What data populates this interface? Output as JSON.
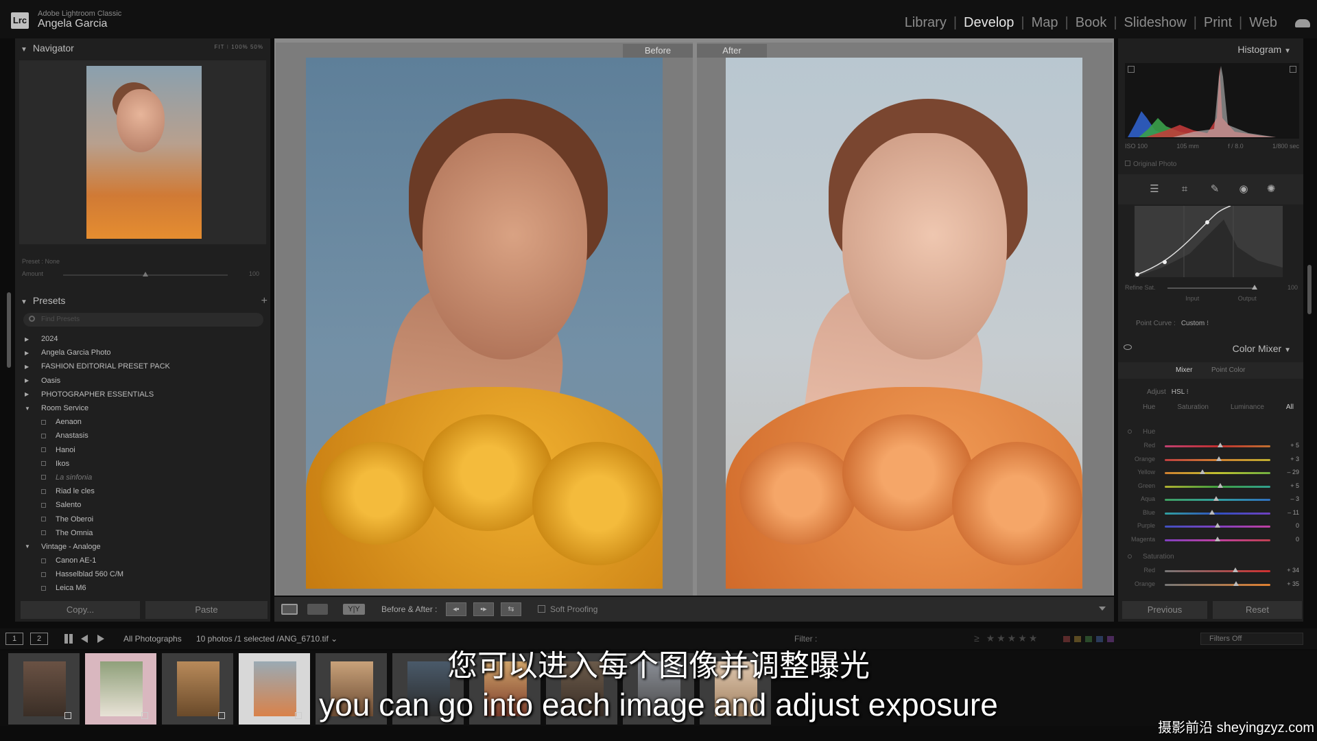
{
  "app": {
    "sub_title": "Adobe Lightroom Classic",
    "logo_text": "Lrc",
    "user_name": "Angela Garcia"
  },
  "modules": [
    "Library",
    "Develop",
    "Map",
    "Book",
    "Slideshow",
    "Print",
    "Web"
  ],
  "active_module": "Develop",
  "navigator": {
    "title": "Navigator",
    "zoom_options": "FIT ⁝  100%  50%"
  },
  "preset_amount": {
    "preset_label": "Preset : None",
    "amount_label": "Amount",
    "amount_value": "100",
    "amount_level": 0.5
  },
  "presets": {
    "title": "Presets",
    "add_label": "+",
    "search_placeholder": "Find Presets",
    "items": [
      {
        "label": "2024",
        "type": "group"
      },
      {
        "label": "Angela Garcia Photo",
        "type": "group"
      },
      {
        "label": "FASHION EDITORIAL PRESET PACK",
        "type": "group"
      },
      {
        "label": "Oasis",
        "type": "group"
      },
      {
        "label": "PHOTOGRAPHER ESSENTIALS",
        "type": "group"
      },
      {
        "label": "Room Service",
        "type": "group-open"
      },
      {
        "label": "Aenaon",
        "type": "child"
      },
      {
        "label": "Anastasis",
        "type": "child"
      },
      {
        "label": "Hanoi",
        "type": "child"
      },
      {
        "label": "Ikos",
        "type": "child"
      },
      {
        "label": "La sinfonia",
        "type": "child-dim"
      },
      {
        "label": "Riad le cles",
        "type": "child"
      },
      {
        "label": "Salento",
        "type": "child"
      },
      {
        "label": "The Oberoi",
        "type": "child"
      },
      {
        "label": "The Omnia",
        "type": "child"
      },
      {
        "label": "Vintage - Analoge",
        "type": "group-open"
      },
      {
        "label": "Canon AE-1",
        "type": "child"
      },
      {
        "label": "Hasselblad 560 C/M",
        "type": "child"
      },
      {
        "label": "Leica M6",
        "type": "child"
      }
    ]
  },
  "left_buttons": {
    "copy": "Copy...",
    "paste": "Paste"
  },
  "compare": {
    "before_label": "Before",
    "after_label": "After"
  },
  "toolbar": {
    "yy_label": "Y|Y",
    "before_after_label": "Before & After :",
    "copy_left": "◂▪",
    "copy_right": "▪▸",
    "swap": "⇆",
    "soft_proofing": "Soft Proofing"
  },
  "histogram": {
    "title": "Histogram",
    "iso": "ISO 100",
    "focal": "105 mm",
    "aperture": "f / 8.0",
    "shutter": "1/800 sec",
    "original_photo": "Original Photo"
  },
  "tone_curve": {
    "refine_label": "Refine Sat.",
    "refine_value": "100",
    "refine_level": 0.98,
    "input_label": "Input",
    "output_label": "Output",
    "point_curve_label": "Point Curve :",
    "point_curve_value": "Custom ⁝"
  },
  "color_mixer": {
    "title": "Color Mixer",
    "tab_mixer": "Mixer",
    "tab_point_color": "Point Color",
    "adjust_label": "Adjust",
    "adjust_value": "HSL ⁝",
    "hsl_tabs": [
      "Hue",
      "Saturation",
      "Luminance",
      "All"
    ],
    "active_hsl_tab": "All",
    "hue_title": "Hue",
    "hue": [
      {
        "name": "Red",
        "value": "+ 5",
        "num": 5
      },
      {
        "name": "Orange",
        "value": "+ 3",
        "num": 3
      },
      {
        "name": "Yellow",
        "value": "– 29",
        "num": -29
      },
      {
        "name": "Green",
        "value": "+ 5",
        "num": 5
      },
      {
        "name": "Aqua",
        "value": "– 3",
        "num": -3
      },
      {
        "name": "Blue",
        "value": "– 11",
        "num": -11
      },
      {
        "name": "Purple",
        "value": "0",
        "num": 0
      },
      {
        "name": "Magenta",
        "value": "0",
        "num": 0
      }
    ],
    "saturation_title": "Saturation",
    "saturation": [
      {
        "name": "Red",
        "value": "+ 34",
        "num": 34
      },
      {
        "name": "Orange",
        "value": "+ 35",
        "num": 35
      }
    ]
  },
  "right_buttons": {
    "previous": "Previous",
    "reset": "Reset"
  },
  "filmbar": {
    "view1": "1",
    "view2": "2",
    "source": "All Photographs",
    "count": "10 photos /1 selected /ANG_6710.tif ⌄",
    "filter_label": "Filter :",
    "stars": "≥ ★★★★★",
    "filters_off": "Filters Off"
  },
  "subtitles": {
    "cn": "您可以进入每个图像并调整曝光",
    "en": "you can go into each image and adjust exposure"
  },
  "watermark": "摄影前沿 sheyingzyz.com",
  "colors": {
    "accent_slider_thumb": "#bbbbbb",
    "panel_bg": "#1f1f1f",
    "center_bg": "#8a8a8a"
  }
}
